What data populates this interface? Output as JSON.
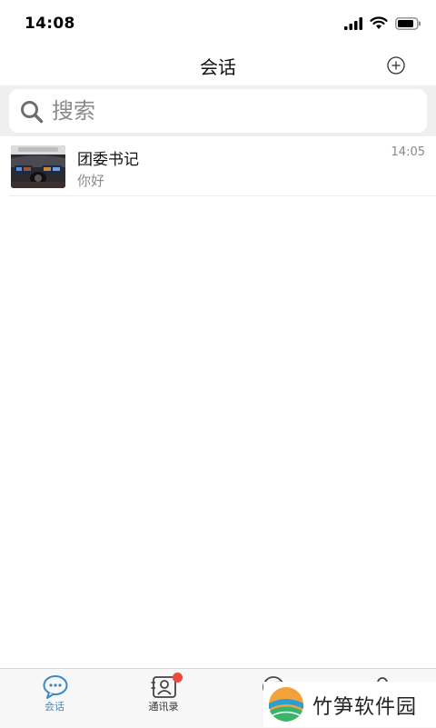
{
  "status_bar": {
    "time": "14:08"
  },
  "nav": {
    "title": "会话"
  },
  "search": {
    "placeholder": "搜索"
  },
  "conversations": [
    {
      "name": "团委书记",
      "preview": "你好",
      "time": "14:05"
    }
  ],
  "tabs": [
    {
      "label": "会话",
      "icon": "chat-bubble-icon",
      "active": true
    },
    {
      "label": "通讯录",
      "icon": "contacts-icon",
      "badge": true
    },
    {
      "label": "",
      "icon": "compass-icon"
    },
    {
      "label": "",
      "icon": "person-icon"
    }
  ],
  "watermark": {
    "text": "竹笋软件园"
  },
  "colors": {
    "accent": "#3a88c6",
    "badge": "#e74c3c",
    "search_bg": "#efefef"
  }
}
